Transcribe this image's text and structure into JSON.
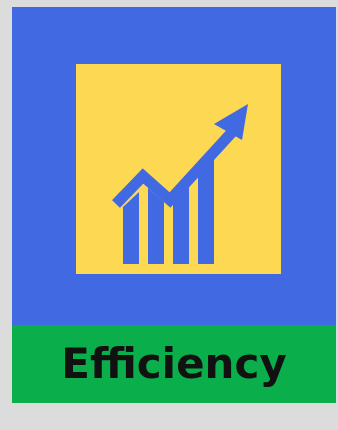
{
  "tile": {
    "label": "Efficiency",
    "icon": "growth-chart-icon"
  },
  "colors": {
    "background": "#dcdcdc",
    "card": "#4169e1",
    "icon_tile": "#fdd853",
    "label_band": "#0aaf4b",
    "icon_ink": "#4169e1",
    "label_text": "#111111"
  }
}
